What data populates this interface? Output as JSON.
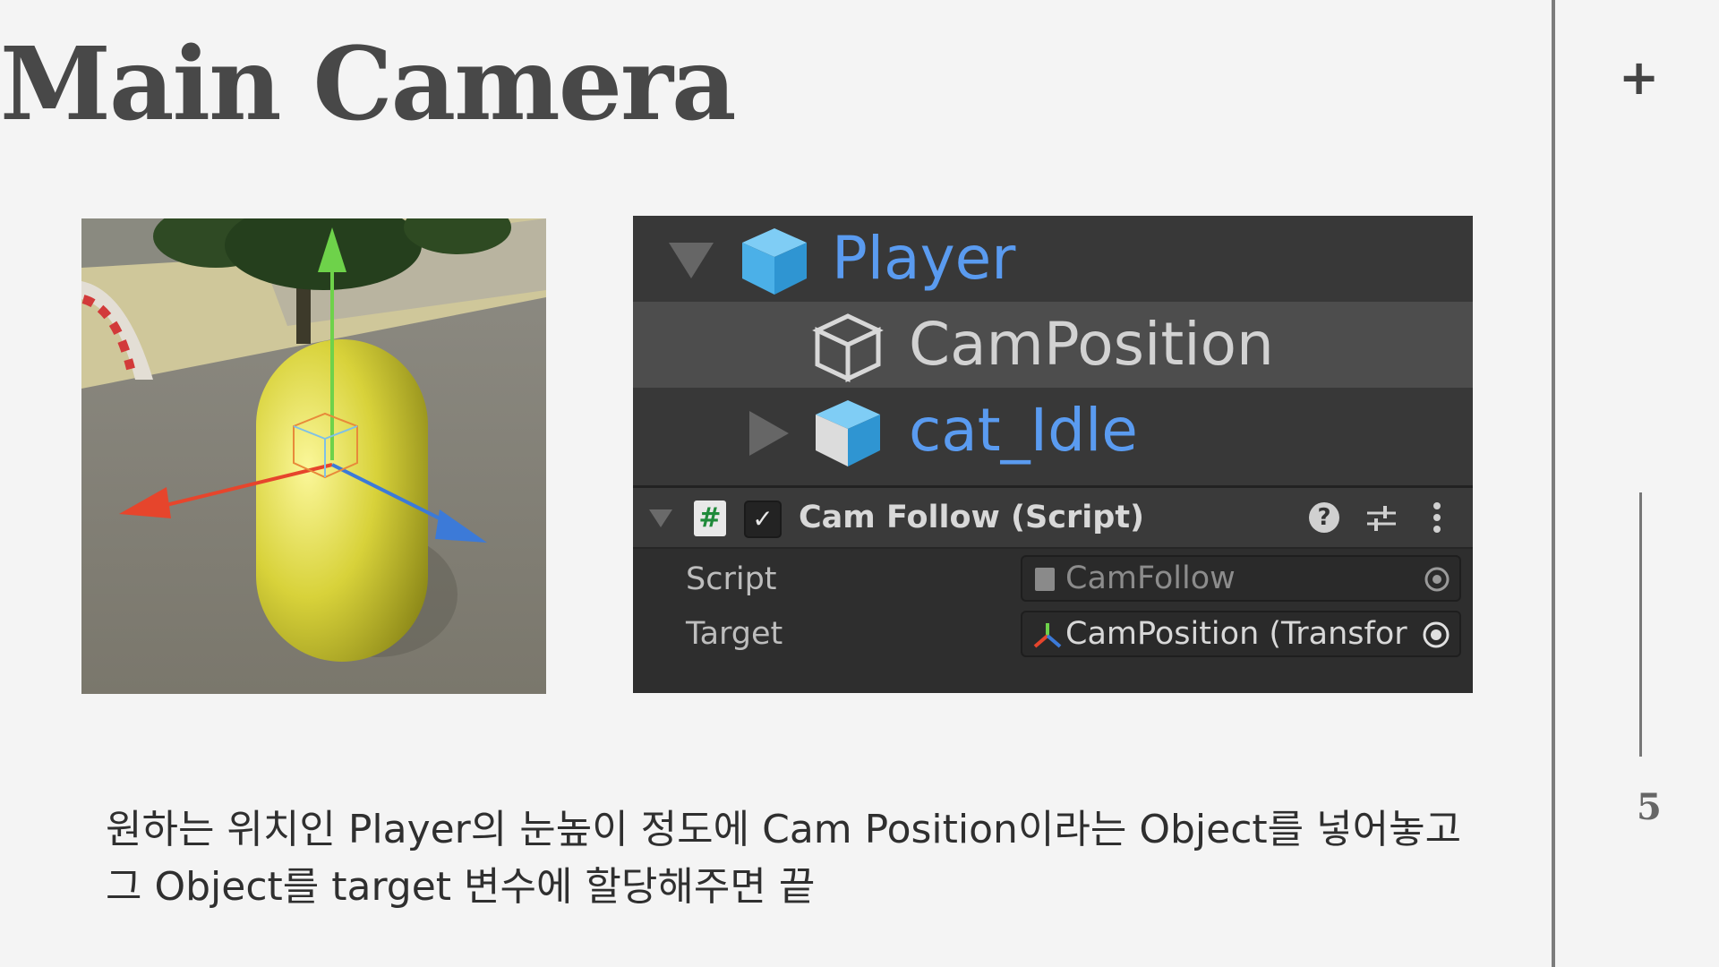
{
  "slide": {
    "title": "Main Camera",
    "page_number": "5",
    "plus_icon": "+",
    "caption_line1": "원하는 위치인 Player의 눈높이 정도에 Cam Position이라는 Object를 넣어놓고",
    "caption_line2": "그 Object를 target 변수에 할당해주면 끝"
  },
  "hierarchy": {
    "items": [
      {
        "label": "Player",
        "icon": "prefab-cube-icon",
        "expanded": true
      },
      {
        "label": "CamPosition",
        "icon": "gameobject-cube-icon",
        "selected": true
      },
      {
        "label": "cat_Idle",
        "icon": "model-prefab-icon",
        "expanded": false
      }
    ]
  },
  "inspector": {
    "component_title": "Cam Follow (Script)",
    "enabled": true,
    "fields": [
      {
        "label": "Script",
        "value": "CamFollow",
        "icon": "script-icon"
      },
      {
        "label": "Target",
        "value": "CamPosition (Transfor",
        "icon": "transform-icon"
      }
    ]
  },
  "colors": {
    "background": "#f4f4f4",
    "title": "#484848",
    "unity_panel": "#383838",
    "unity_selected": "#4d4d4d",
    "prefab_blue": "#5a9bf0",
    "capsule_yellow": "#d8d23a"
  }
}
